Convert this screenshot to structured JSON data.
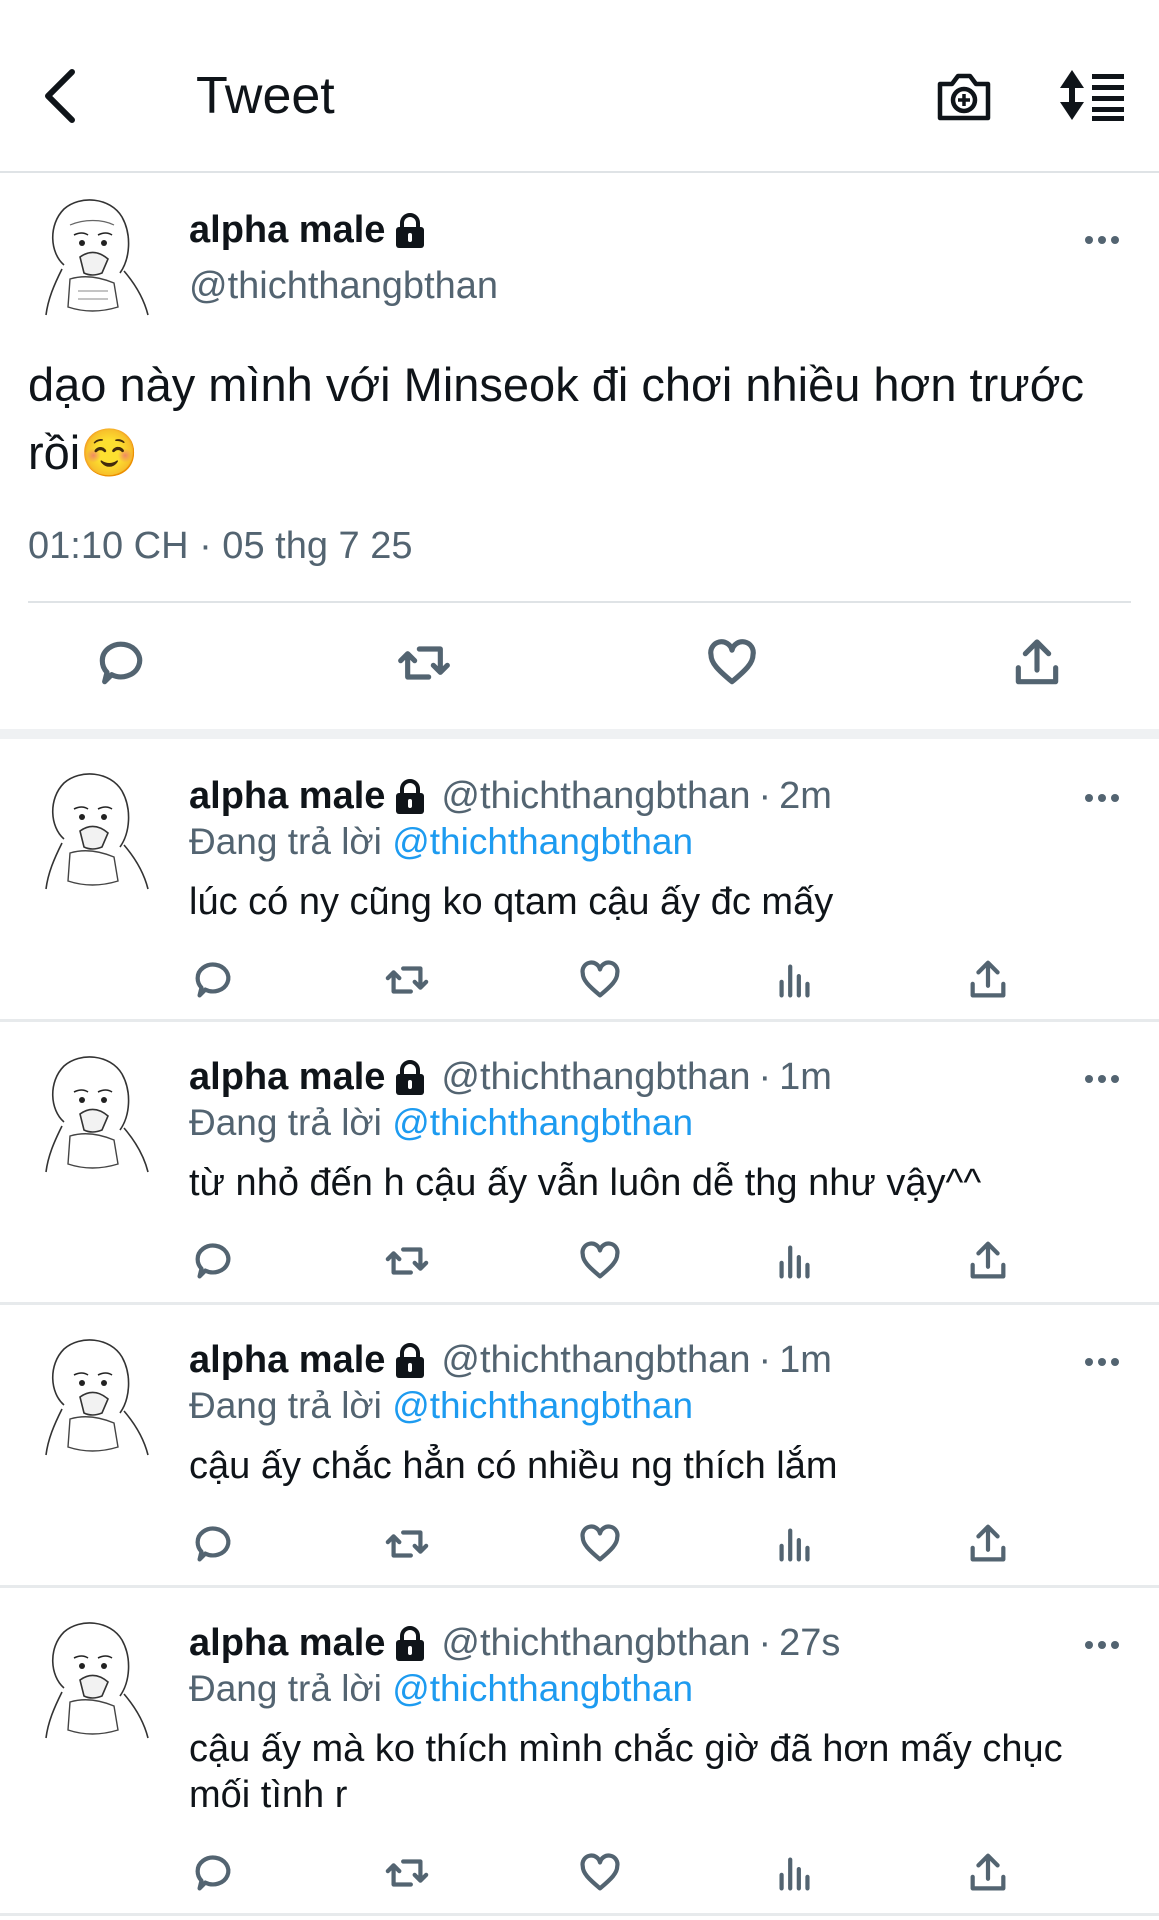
{
  "header": {
    "title": "Tweet"
  },
  "main_tweet": {
    "name": "alpha male",
    "handle": "@thichthangbthan",
    "text": "dạo này mình với Minseok đi chơi nhiều hơn trước rồi☺️",
    "datetime": "01:10 CH · 05 thg 7 25"
  },
  "replies": [
    {
      "name": "alpha male",
      "handle": "@thichthangbthan",
      "time": "2m",
      "replying_label": "Đang trả lời",
      "replying_to": "@thichthangbthan",
      "text": "lúc có ny cũng ko qtam cậu ấy đc mấy"
    },
    {
      "name": "alpha male",
      "handle": "@thichthangbthan",
      "time": "1m",
      "replying_label": "Đang trả lời",
      "replying_to": "@thichthangbthan",
      "text": "từ nhỏ đến h cậu ấy vẫn luôn dễ thg như vậy^^"
    },
    {
      "name": "alpha male",
      "handle": "@thichthangbthan",
      "time": "1m",
      "replying_label": "Đang trả lời",
      "replying_to": "@thichthangbthan",
      "text": "cậu ấy chắc hẳn có nhiều ng thích lắm"
    },
    {
      "name": "alpha male",
      "handle": "@thichthangbthan",
      "time": "27s",
      "replying_label": "Đang trả lời",
      "replying_to": "@thichthangbthan",
      "text": "cậu ấy mà ko thích mình chắc giờ đã hơn mấy chục mối tình r"
    }
  ],
  "icons": {
    "header": [
      "back-arrow-icon",
      "camera-icon",
      "sort-icon"
    ],
    "actions": [
      "reply-icon",
      "retweet-icon",
      "like-icon",
      "views-icon",
      "share-icon"
    ],
    "badge": "lock-icon",
    "more": "more-icon"
  },
  "colors": {
    "accent": "#1d9bf0",
    "text": "#0f1419",
    "secondary": "#536471",
    "divider": "#e7eaec"
  }
}
